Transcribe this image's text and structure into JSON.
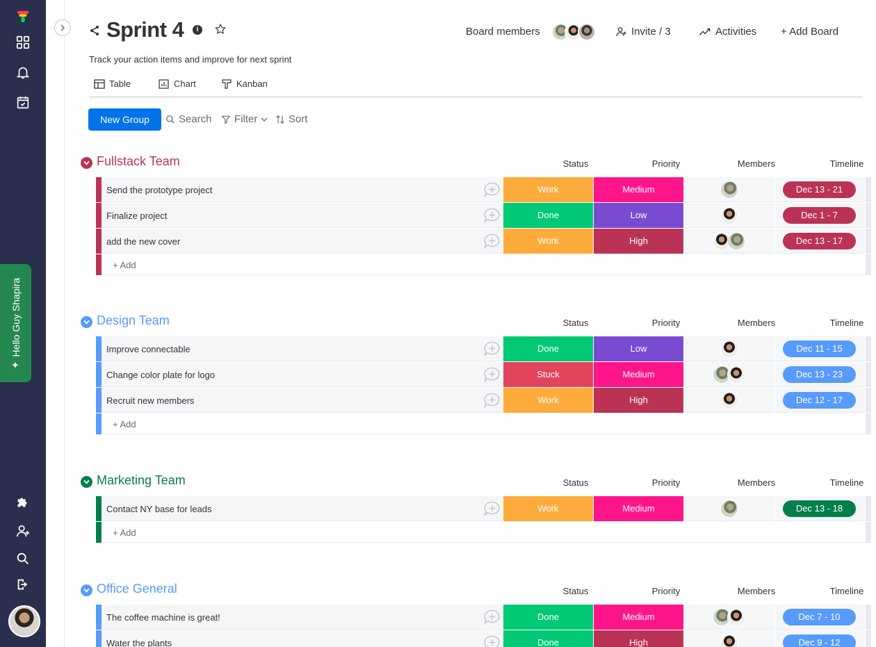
{
  "header": {
    "title": "Sprint 4",
    "description": "Track your action items and improve for next sprint",
    "board_members_label": "Board members",
    "invite_label": "Invite / 3",
    "activities_label": "Activities",
    "add_board_label": "+ Add Board"
  },
  "views": {
    "table": "Table",
    "chart": "Chart",
    "kanban": "Kanban"
  },
  "toolbar": {
    "new_group": "New Group",
    "search": "Search",
    "filter": "Filter",
    "sort": "Sort"
  },
  "sidebar": {
    "hello": "Hello Guy Shapira"
  },
  "columns": {
    "status": "Status",
    "priority": "Priority",
    "members": "Members",
    "timeline": "Timeline"
  },
  "add_label": "+ Add",
  "colors": {
    "Work": "#fdab3d",
    "Done": "#00c875",
    "Stuck": "#e2445c",
    "Medium": "#ff158a",
    "Low": "#784bd1",
    "High": "#bb3354"
  },
  "groups": [
    {
      "title": "Fullstack Team",
      "color": "#bb3354",
      "timeline_color": "#bb3354",
      "items": [
        {
          "name": "Send the prototype project",
          "status": "Work",
          "priority": "Medium",
          "members": [
            "a"
          ],
          "timeline": "Dec 13 - 21"
        },
        {
          "name": "Finalize project",
          "status": "Done",
          "priority": "Low",
          "members": [
            "b"
          ],
          "timeline": "Dec 1 - 7"
        },
        {
          "name": "add the new cover",
          "status": "Work",
          "priority": "High",
          "members": [
            "b",
            "a"
          ],
          "timeline": "Dec 13 - 17"
        }
      ]
    },
    {
      "title": "Design Team",
      "color": "#579bfc",
      "timeline_color": "#579bfc",
      "items": [
        {
          "name": "Improve connectable",
          "status": "Done",
          "priority": "Low",
          "members": [
            "b"
          ],
          "timeline": "Dec 11 - 15"
        },
        {
          "name": "Change color plate for logo",
          "status": "Stuck",
          "priority": "Medium",
          "members": [
            "a",
            "b"
          ],
          "timeline": "Dec 13 - 23"
        },
        {
          "name": "Recruit new members",
          "status": "Work",
          "priority": "High",
          "members": [
            "b"
          ],
          "timeline": "Dec 12 - 17"
        }
      ]
    },
    {
      "title": "Marketing Team",
      "color": "#037f4c",
      "timeline_color": "#037f4c",
      "items": [
        {
          "name": "Contact NY base for leads",
          "status": "Work",
          "priority": "Medium",
          "members": [
            "a"
          ],
          "timeline": "Dec 13 - 18"
        }
      ]
    },
    {
      "title": "Office General",
      "color": "#579bfc",
      "timeline_color": "#579bfc",
      "items": [
        {
          "name": "The coffee machine is great!",
          "status": "Done",
          "priority": "Medium",
          "members": [
            "a",
            "b"
          ],
          "timeline": "Dec 7 - 10"
        },
        {
          "name": "Water the plants",
          "status": "Done",
          "priority": "High",
          "members": [
            "b"
          ],
          "timeline": "Dec 9 - 12"
        }
      ]
    }
  ]
}
